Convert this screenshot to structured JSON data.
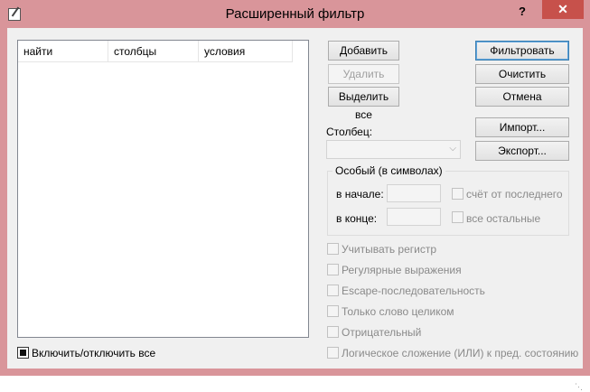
{
  "window": {
    "title": "Расширенный фильтр",
    "help": "?",
    "close": "✕"
  },
  "list": {
    "columns": [
      "найти",
      "столбцы",
      "условия"
    ]
  },
  "buttons": {
    "add": "Добавить",
    "delete": "Удалить",
    "select_all": "Выделить все",
    "filter": "Фильтровать",
    "clear": "Очистить",
    "cancel": "Отмена",
    "import": "Импорт...",
    "export": "Экспорт..."
  },
  "column": {
    "label": "Столбец:",
    "value": ""
  },
  "special": {
    "title": "Особый (в символах)",
    "start_label": "в начале:",
    "end_label": "в конце:",
    "count_from_last": "счёт от последнего",
    "all_others": "все остальные"
  },
  "options": [
    "Учитывать регистр",
    "Регулярные выражения",
    "Escape-последовательность",
    "Только слово целиком",
    "Отрицательный",
    "Логическое сложение (ИЛИ) к пред. состоянию"
  ],
  "toggle_all": "Включить/отключить все"
}
